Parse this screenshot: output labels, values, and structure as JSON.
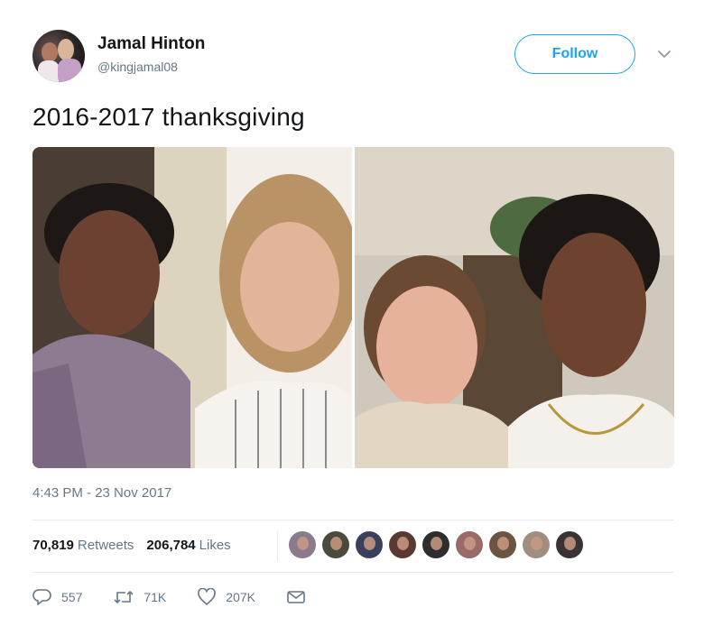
{
  "author": {
    "name": "Jamal Hinton",
    "handle": "@kingjamal08"
  },
  "follow_label": "Follow",
  "tweet_text": "2016-2017 thanksgiving",
  "timestamp": "4:43 PM - 23 Nov 2017",
  "stats": {
    "retweets_count": "70,819",
    "retweets_label": "Retweets",
    "likes_count": "206,784",
    "likes_label": "Likes"
  },
  "liker_avatar_colors": [
    "#8b7a8c",
    "#4a4a3e",
    "#3a3f5c",
    "#5a3a30",
    "#2e2e2e",
    "#9a6a68",
    "#6b5540",
    "#a08f80",
    "#3b3233"
  ],
  "actions": {
    "reply_count": "557",
    "retweet_count": "71K",
    "like_count": "207K"
  },
  "colors": {
    "accent": "#1da1f2",
    "secondary_text": "#657786",
    "primary_text": "#14171a",
    "divider": "#e6ecf0"
  },
  "icons": [
    "chevron-down-icon",
    "reply-icon",
    "retweet-icon",
    "heart-icon",
    "message-icon"
  ]
}
